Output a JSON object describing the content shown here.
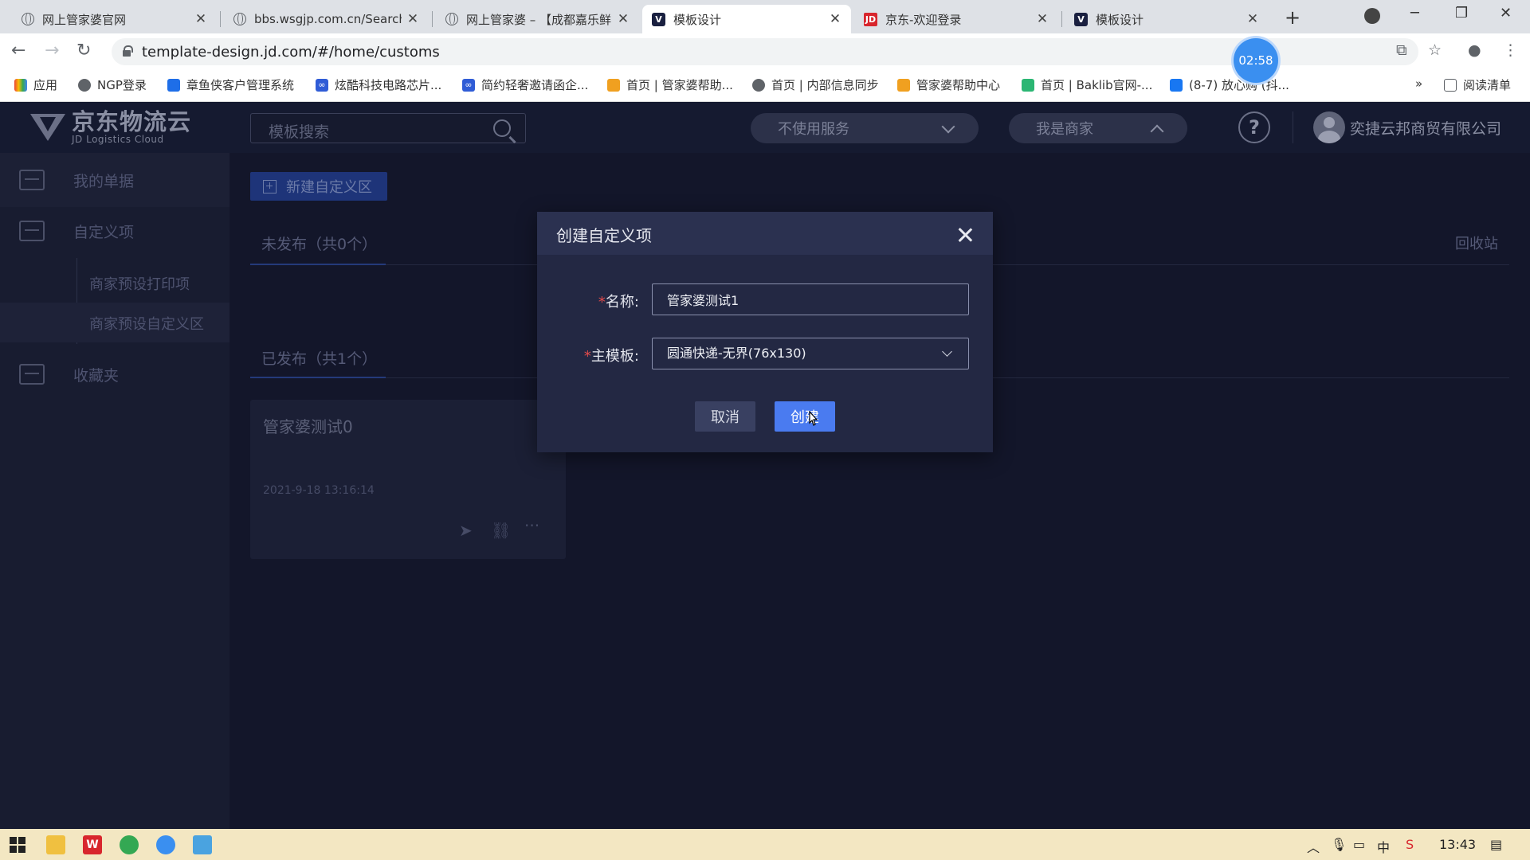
{
  "browser": {
    "tabs": [
      {
        "title": "网上管家婆官网",
        "favicon": "globe-icon",
        "active": false
      },
      {
        "title": "bbs.wsgjp.com.cn/Search.",
        "favicon": "globe-icon",
        "active": false
      },
      {
        "title": "网上管家婆 – 【成都嘉乐鲜",
        "favicon": "globe-icon",
        "active": false
      },
      {
        "title": "模板设计",
        "favicon": "v-logo-icon",
        "active": true
      },
      {
        "title": "京东-欢迎登录",
        "favicon": "jd-logo-icon",
        "active": false
      },
      {
        "title": "模板设计",
        "favicon": "v-logo-icon",
        "active": false
      }
    ],
    "url": "template-design.jd.com/#/home/customs",
    "timer": "02:58",
    "bookmarks": [
      {
        "label": "应用",
        "icon": "apps-grid-icon"
      },
      {
        "label": "NGP登录",
        "icon": "globe-icon"
      },
      {
        "label": "章鱼侠客户管理系统",
        "icon": "octopus-icon"
      },
      {
        "label": "炫酷科技电路芯片...",
        "icon": "infinity-icon"
      },
      {
        "label": "简约轻奢邀请函企...",
        "icon": "infinity-icon"
      },
      {
        "label": "首页 | 管家婆帮助...",
        "icon": "house-icon"
      },
      {
        "label": "首页 | 内部信息同步",
        "icon": "globe-icon"
      },
      {
        "label": "管家婆帮助中心",
        "icon": "house-icon"
      },
      {
        "label": "首页 | Baklib官网-...",
        "icon": "leaf-icon"
      },
      {
        "label": "(8-7) 放心购 (抖...",
        "icon": "butterfly-icon"
      }
    ],
    "reading_list": "阅读清单",
    "more_bookmarks": "»"
  },
  "header": {
    "brand_cn": "京东物流云",
    "brand_en": "JD Logistics Cloud",
    "search_placeholder": "模板搜索",
    "service_dropdown": "不使用服务",
    "role_dropdown": "我是商家",
    "help": "?",
    "company": "奕捷云邦商贸有限公司"
  },
  "sidebar": {
    "items": [
      {
        "label": "我的单据",
        "icon": "inbox-icon"
      },
      {
        "label": "自定义项",
        "icon": "inbox-icon"
      },
      {
        "label": "收藏夹",
        "icon": "star-folder-icon"
      }
    ],
    "subitems": [
      {
        "label": "商家预设打印项"
      },
      {
        "label": "商家预设自定义区",
        "active": true
      }
    ]
  },
  "main": {
    "new_button": "新建自定义区",
    "unpublished": "未发布（共0个）",
    "published": "已发布（共1个）",
    "recycle_bin": "回收站",
    "card": {
      "name": "管家婆测试0",
      "time": "2021-9-18 13:16:14"
    }
  },
  "dialog": {
    "title": "创建自定义项",
    "name_label": "名称:",
    "name_value": "管家婆测试1",
    "template_label": "主模板:",
    "template_value": "圆通快递-无界(76x130)",
    "required_mark": "*",
    "cancel": "取消",
    "create": "创建"
  },
  "taskbar": {
    "time": "13:43",
    "ime": "中"
  },
  "colors": {
    "primary": "#4a7bf0",
    "required": "#e34b4b",
    "dialog_bg": "#232843",
    "page_bg": "#13162a"
  }
}
